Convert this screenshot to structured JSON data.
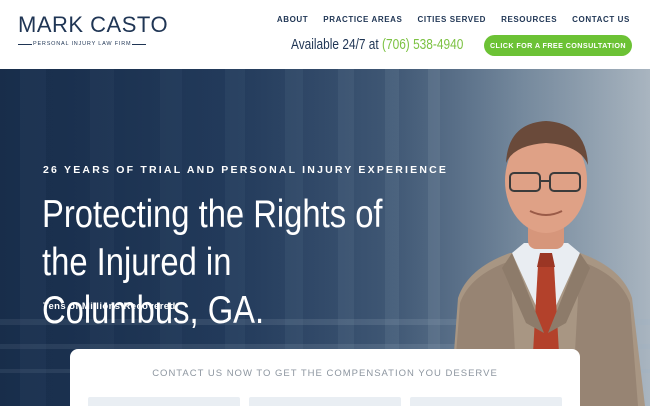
{
  "header": {
    "logo_name": "MARK CASTO",
    "logo_tagline": "PERSONAL INJURY LAW FIRM",
    "nav": [
      {
        "label": "ABOUT"
      },
      {
        "label": "PRACTICE AREAS"
      },
      {
        "label": "CITIES SERVED"
      },
      {
        "label": "RESOURCES"
      },
      {
        "label": "CONTACT US"
      }
    ],
    "availability_text": "Available 24/7 at ",
    "phone": "(706) 538-4940",
    "cta_label": "CLICK FOR A FREE CONSULTATION"
  },
  "hero": {
    "eyebrow": "26 YEARS OF TRIAL AND PERSONAL INJURY EXPERIENCE",
    "headline": "Protecting the Rights of the Injured in Columbus, GA.",
    "subline": "Tens of Millions Recovered"
  },
  "contact_card": {
    "title": "CONTACT US NOW TO GET THE COMPENSATION YOU DESERVE"
  },
  "colors": {
    "navy": "#1f3554",
    "accent_green": "#6cc235",
    "phone_green": "#7cc242"
  }
}
